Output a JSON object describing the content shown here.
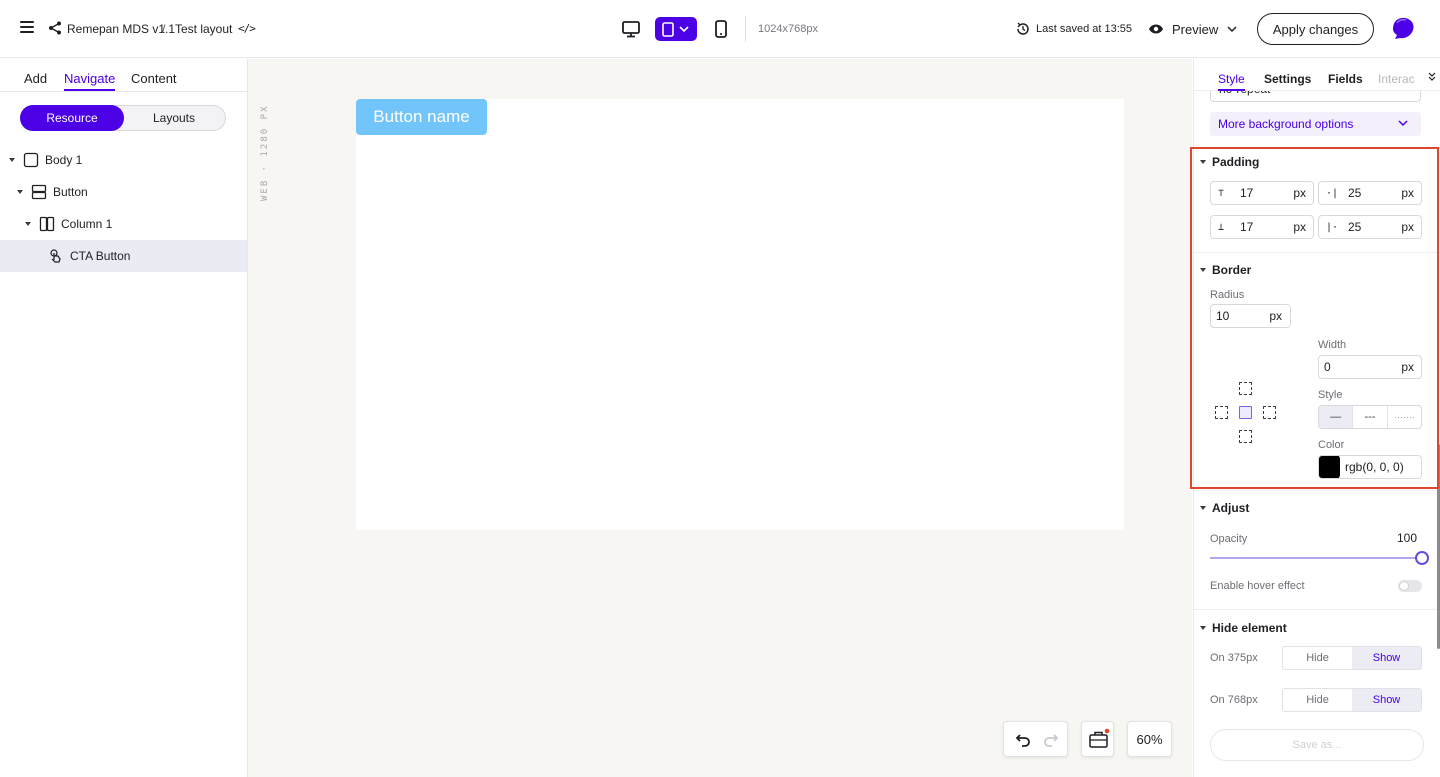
{
  "header": {
    "project": "Remepan MDS v1.1",
    "separator": "/",
    "layout": "Test layout",
    "resolution": "1024x768px",
    "last_saved": "Last saved at 13:55",
    "preview": "Preview",
    "apply": "Apply changes"
  },
  "left": {
    "tabs": [
      "Add",
      "Navigate",
      "Content"
    ],
    "segments": [
      "Resource",
      "Layouts"
    ],
    "tree": [
      {
        "label": "Body 1",
        "icon": "frame-icon"
      },
      {
        "label": "Button",
        "icon": "rows-icon"
      },
      {
        "label": "Column 1",
        "icon": "columns-icon"
      },
      {
        "label": "CTA Button",
        "icon": "pointer-icon"
      }
    ]
  },
  "canvas": {
    "ruler": "WEB · 1280 PX",
    "button_label": "Button name",
    "zoom": "60%"
  },
  "right": {
    "tabs": [
      "Style",
      "Settings",
      "Fields",
      "Interac"
    ],
    "repeat_value": "no-repeat",
    "more_background": "More background options",
    "padding": {
      "title": "Padding",
      "top": "17",
      "right": "25",
      "bottom": "17",
      "left": "25",
      "unit": "px"
    },
    "border": {
      "title": "Border",
      "radius_label": "Radius",
      "radius": "10",
      "unit": "px",
      "width_label": "Width",
      "width": "0",
      "style_label": "Style",
      "styles": [
        "—",
        "---",
        "·······"
      ],
      "color_label": "Color",
      "color_value": "rgb(0, 0, 0)",
      "color_hex": "#000000"
    },
    "adjust": {
      "title": "Adjust",
      "opacity_label": "Opacity",
      "opacity": "100",
      "hover_label": "Enable hover effect"
    },
    "hide": {
      "title": "Hide element",
      "rows": [
        {
          "label": "On 375px",
          "hide": "Hide",
          "show": "Show"
        },
        {
          "label": "On 768px",
          "hide": "Hide",
          "show": "Show"
        }
      ]
    },
    "save_as": "Save as..."
  },
  "colors": {
    "accent": "#4b00e6",
    "cta": "#71c5fb",
    "highlight": "#e0462e"
  }
}
